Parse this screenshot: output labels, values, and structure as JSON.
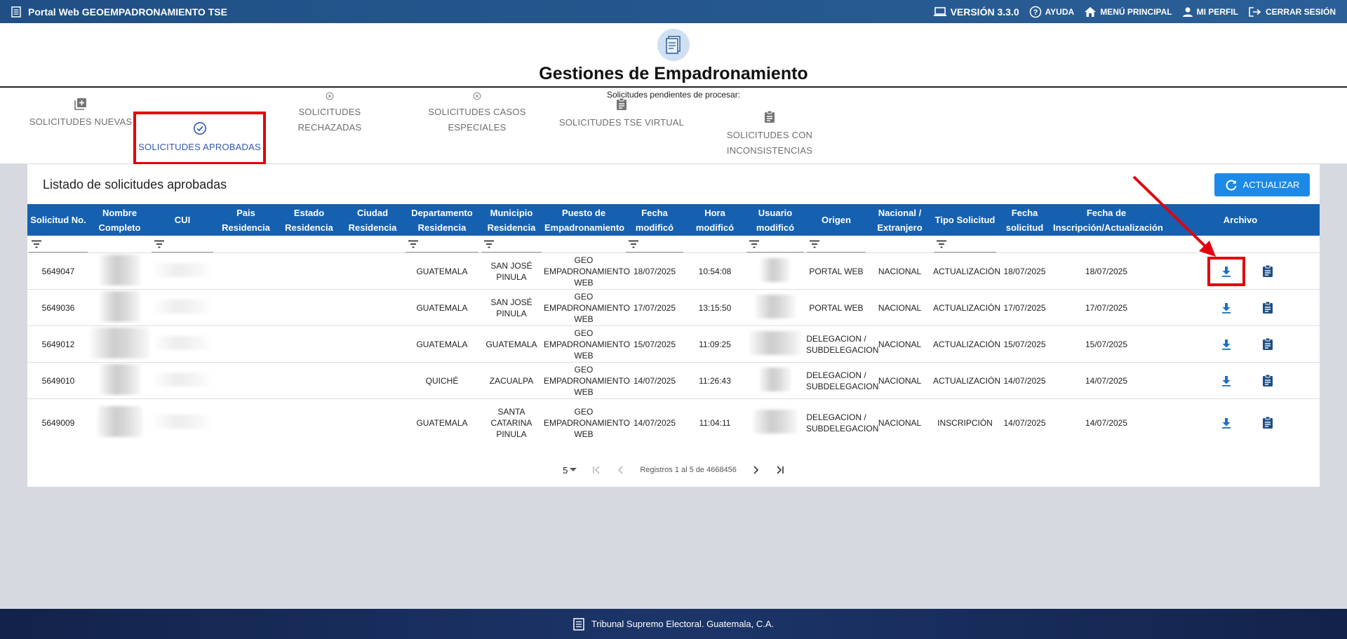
{
  "topbar": {
    "app_title": "Portal Web GEOEMPADRONAMIENTO TSE",
    "version": "VERSIÓN 3.3.0",
    "help": "AYUDA",
    "main_menu": "MENÚ PRINCIPAL",
    "profile": "MI PERFIL",
    "logout": "CERRAR SESIÓN"
  },
  "header": {
    "title": "Gestiones de Empadronamiento",
    "subtitle": "Solicitudes pendientes de procesar:"
  },
  "tabs": [
    {
      "label": "SOLICITUDES NUEVAS",
      "icon": "add-box-icon"
    },
    {
      "label": "SOLICITUDES APROBADAS",
      "icon": "check-circle-icon",
      "active": true
    },
    {
      "label": "SOLICITUDES RECHAZADAS",
      "icon": "x-circle-icon"
    },
    {
      "label": "SOLICITUDES CASOS ESPECIALES",
      "icon": "x-circle-icon"
    },
    {
      "label": "SOLICITUDES TSE VIRTUAL",
      "icon": "clipboard-icon"
    },
    {
      "label": "SOLICITUDES CON INCONSISTENCIAS",
      "icon": "clipboard-icon"
    }
  ],
  "panel": {
    "title": "Listado de solicitudes aprobadas",
    "refresh_label": "ACTUALIZAR"
  },
  "table": {
    "headers": [
      "Solicitud No.",
      "Nombre Completo",
      "CUI",
      "Pais Residencia",
      "Estado Residencia",
      "Ciudad Residencia",
      "Departamento Residencia",
      "Municipio Residencia",
      "Puesto de Empadronamiento",
      "Fecha modificó",
      "Hora modificó",
      "Usuario modificó",
      "Origen",
      "Nacional / Extranjero",
      "Tipo Solicitud",
      "Fecha solicitud",
      "Fecha de Inscripción/Actualización",
      "Archivo"
    ],
    "rows": [
      {
        "solicitud": "5649047",
        "departamento": "GUATEMALA",
        "municipio": "SAN JOSÉ PINULA",
        "puesto": "GEO EMPADRONAMIENTO WEB",
        "fecha_mod": "18/07/2025",
        "hora_mod": "10:54:08",
        "origen": "PORTAL WEB",
        "nacional": "NACIONAL",
        "tipo": "ACTUALIZACIÓN",
        "fecha_sol": "18/07/2025",
        "fecha_insc": "18/07/2025"
      },
      {
        "solicitud": "5649036",
        "departamento": "GUATEMALA",
        "municipio": "SAN JOSÉ PINULA",
        "puesto": "GEO EMPADRONAMIENTO WEB",
        "fecha_mod": "17/07/2025",
        "hora_mod": "13:15:50",
        "origen": "PORTAL WEB",
        "nacional": "NACIONAL",
        "tipo": "ACTUALIZACIÓN",
        "fecha_sol": "17/07/2025",
        "fecha_insc": "17/07/2025"
      },
      {
        "solicitud": "5649012",
        "departamento": "GUATEMALA",
        "municipio": "GUATEMALA",
        "puesto": "GEO EMPADRONAMIENTO WEB",
        "fecha_mod": "15/07/2025",
        "hora_mod": "11:09:25",
        "origen": "DELEGACION / SUBDELEGACION",
        "nacional": "NACIONAL",
        "tipo": "ACTUALIZACIÓN",
        "fecha_sol": "15/07/2025",
        "fecha_insc": "15/07/2025"
      },
      {
        "solicitud": "5649010",
        "departamento": "QUICHÉ",
        "municipio": "ZACUALPA",
        "puesto": "GEO EMPADRONAMIENTO WEB",
        "fecha_mod": "14/07/2025",
        "hora_mod": "11:26:43",
        "origen": "DELEGACION / SUBDELEGACION",
        "nacional": "NACIONAL",
        "tipo": "ACTUALIZACIÓN",
        "fecha_sol": "14/07/2025",
        "fecha_insc": "14/07/2025"
      },
      {
        "solicitud": "5649009",
        "departamento": "GUATEMALA",
        "municipio": "SANTA CATARINA PINULA",
        "puesto": "GEO EMPADRONAMIENTO WEB",
        "fecha_mod": "14/07/2025",
        "hora_mod": "11:04:11",
        "origen": "DELEGACION / SUBDELEGACION",
        "nacional": "NACIONAL",
        "tipo": "INSCRIPCIÓN",
        "fecha_sol": "14/07/2025",
        "fecha_insc": "14/07/2025"
      }
    ]
  },
  "pager": {
    "page_size": "5",
    "range_text": "Registros 1 al 5 de 4668456"
  },
  "footer": {
    "text": "Tribunal Supremo Electoral. Guatemala, C.A."
  },
  "colors": {
    "topbar": "#1f4f85",
    "table_header": "#1660b0",
    "button": "#1c8ae6",
    "active_tab": "#3457b0",
    "highlight": "#e3000f",
    "footer": "#13224a"
  }
}
